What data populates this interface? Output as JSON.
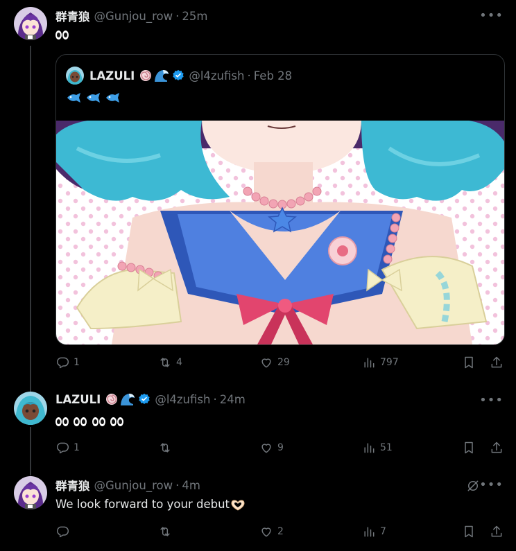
{
  "tweets": [
    {
      "name": "群青狼",
      "handle": "@Gunjou_row",
      "time": "25m",
      "replies": "1",
      "retweets": "4",
      "likes": "29",
      "views": "797",
      "quote": {
        "name": "LAZULI",
        "handle": "@l4zufish",
        "time": "Feb 28"
      }
    },
    {
      "name": "LAZULI",
      "handle": "@l4zufish",
      "time": "24m",
      "replies": "1",
      "retweets": "",
      "likes": "9",
      "views": "51"
    },
    {
      "name": "群青狼",
      "handle": "@Gunjou_row",
      "time": "4m",
      "text": "We look forward to your debut",
      "replies": "",
      "retweets": "",
      "likes": "2",
      "views": "7"
    }
  ],
  "colors": {
    "background": "#000000",
    "text_primary": "#e7e9ea",
    "text_secondary": "#71767b",
    "accent": "#1d9bf0",
    "border": "#2f3336"
  },
  "icons": [
    "eyes-emoji",
    "spiral-shell-emoji",
    "wave-emoji",
    "verified-badge-icon",
    "fish-emoji",
    "heart-hands-emoji",
    "reply-icon",
    "retweet-icon",
    "like-icon",
    "views-icon",
    "bookmark-icon",
    "share-icon",
    "more-icon",
    "grok-icon"
  ]
}
